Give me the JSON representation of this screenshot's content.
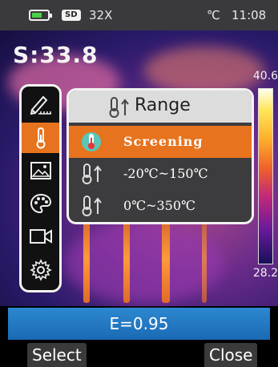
{
  "status_bar": {
    "battery_level": 0.6,
    "sd_label": "SD",
    "zoom": "32X",
    "unit": "℃",
    "time": "11:08"
  },
  "readout": {
    "spot_temp": "S:33.8"
  },
  "color_scale": {
    "max": "40.6",
    "min": "28.2"
  },
  "sidebar": {
    "items": [
      {
        "icon": "pen-ruler-icon",
        "label": "measure"
      },
      {
        "icon": "thermometer-icon",
        "label": "range",
        "active": true
      },
      {
        "icon": "image-icon",
        "label": "image"
      },
      {
        "icon": "palette-icon",
        "label": "palette"
      },
      {
        "icon": "video-camera-icon",
        "label": "video"
      },
      {
        "icon": "gear-icon",
        "label": "settings"
      }
    ]
  },
  "popup": {
    "title": "Range",
    "options": [
      {
        "label": "Screening",
        "selected": true
      },
      {
        "label": "-20℃~150℃"
      },
      {
        "label": "0℃~350℃"
      }
    ]
  },
  "emissivity": {
    "text": "E=0.95"
  },
  "softkeys": {
    "left": "Select",
    "right": "Close"
  },
  "colors": {
    "accent": "#e8731e",
    "emissivity_bar": "#1a6ab4",
    "status_bg": "#3a3a3c"
  }
}
